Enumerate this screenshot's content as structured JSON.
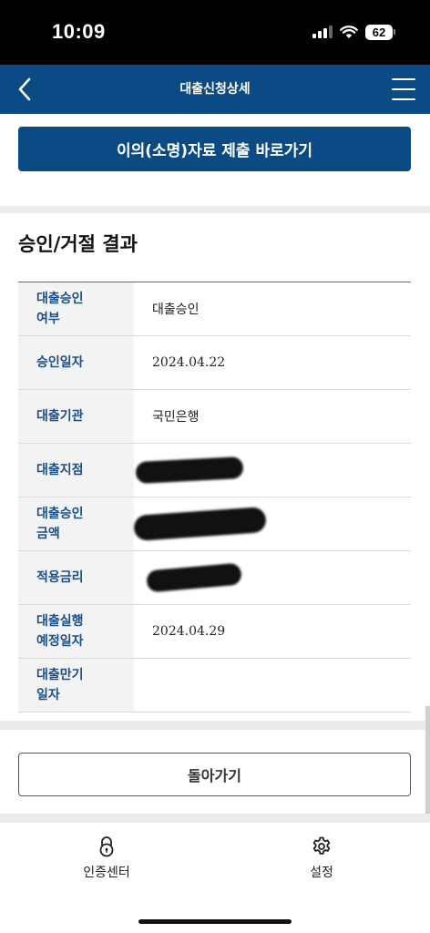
{
  "status_bar": {
    "time": "10:09",
    "battery": "62"
  },
  "header": {
    "title": "대출신청상세"
  },
  "objection_button": {
    "label": "이의(소명)자료 제출  바로가기"
  },
  "section": {
    "title": "승인/거절 결과"
  },
  "result_rows": [
    {
      "label": "대출승인\n여부",
      "value": "대출승인"
    },
    {
      "label": "승인일자",
      "value": "2024.04.22"
    },
    {
      "label": "대출기관",
      "value": "국민은행"
    },
    {
      "label": "대출지점",
      "value": ""
    },
    {
      "label": "대출승인\n금액",
      "value": ""
    },
    {
      "label": "적용금리",
      "value": ""
    },
    {
      "label": "대출실행\n예정일자",
      "value": "2024.04.29"
    },
    {
      "label": "대출만기\n일자",
      "value": ""
    }
  ],
  "back_button": {
    "label": "돌아가기"
  },
  "bottom_nav": {
    "items": [
      {
        "label": "인증센터",
        "icon": "lock-icon"
      },
      {
        "label": "설정",
        "icon": "gear-icon"
      }
    ]
  },
  "colors": {
    "primary": "#0c4a85",
    "label_text": "#1a4f8a"
  }
}
